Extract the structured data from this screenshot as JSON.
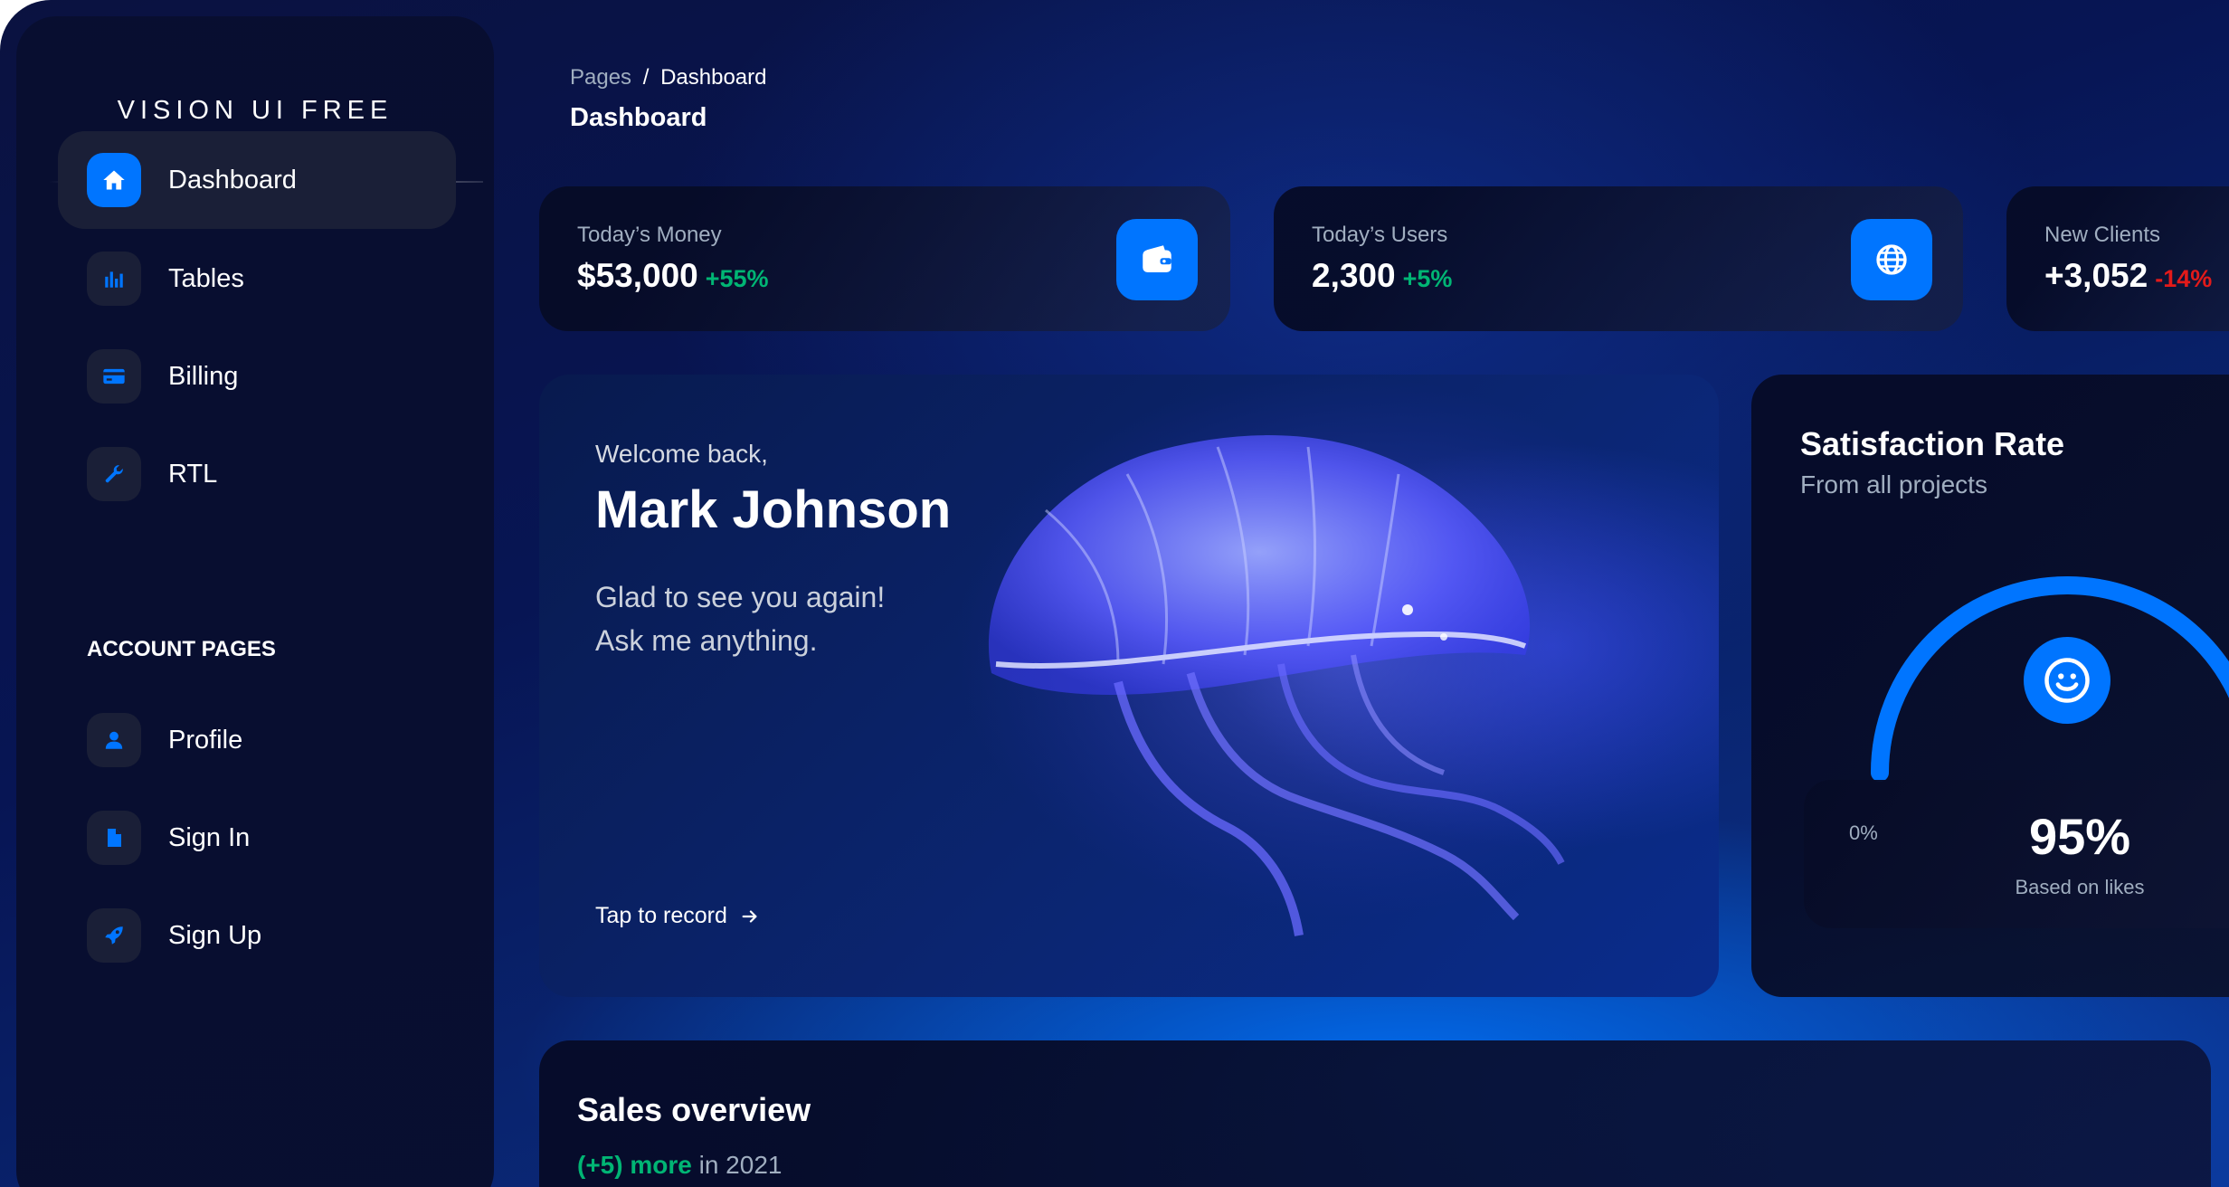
{
  "brand": "VISION UI FREE",
  "sidebar": {
    "items": [
      {
        "label": "Dashboard",
        "icon": "home-icon",
        "active": true
      },
      {
        "label": "Tables",
        "icon": "bar-chart-icon"
      },
      {
        "label": "Billing",
        "icon": "credit-card-icon"
      },
      {
        "label": "RTL",
        "icon": "wrench-icon"
      }
    ],
    "section_title": "ACCOUNT PAGES",
    "account_items": [
      {
        "label": "Profile",
        "icon": "person-icon"
      },
      {
        "label": "Sign In",
        "icon": "document-icon"
      },
      {
        "label": "Sign Up",
        "icon": "rocket-icon"
      }
    ]
  },
  "header": {
    "breadcrumb_parent": "Pages",
    "breadcrumb_separator": "/",
    "breadcrumb_current": "Dashboard",
    "title": "Dashboard"
  },
  "stats": [
    {
      "label": "Today’s Money",
      "value": "$53,000",
      "change": "+55%",
      "trend": "up",
      "icon": "wallet-icon"
    },
    {
      "label": "Today’s Users",
      "value": "2,300",
      "change": "+5%",
      "trend": "up",
      "icon": "globe-icon"
    },
    {
      "label": "New Clients",
      "value": "+3,052",
      "change": "-14%",
      "trend": "down",
      "icon": "document-icon"
    }
  ],
  "welcome": {
    "greeting": "Welcome back,",
    "name": "Mark Johnson",
    "line1": "Glad to see you again!",
    "line2": "Ask me anything.",
    "link": "Tap to record"
  },
  "satisfaction": {
    "title": "Satisfaction Rate",
    "subtitle": "From all projects",
    "min_label": "0%",
    "value": "95%",
    "value_fraction": 0.95,
    "note": "Based on likes"
  },
  "sales": {
    "title": "Sales overview",
    "highlight": "(+5) more",
    "suffix": "in 2021"
  },
  "colors": {
    "accent": "#0075ff",
    "positive": "#01b574",
    "negative": "#e31a1a",
    "muted": "#a0aec0",
    "sidebar_active": "#1a1f37"
  }
}
